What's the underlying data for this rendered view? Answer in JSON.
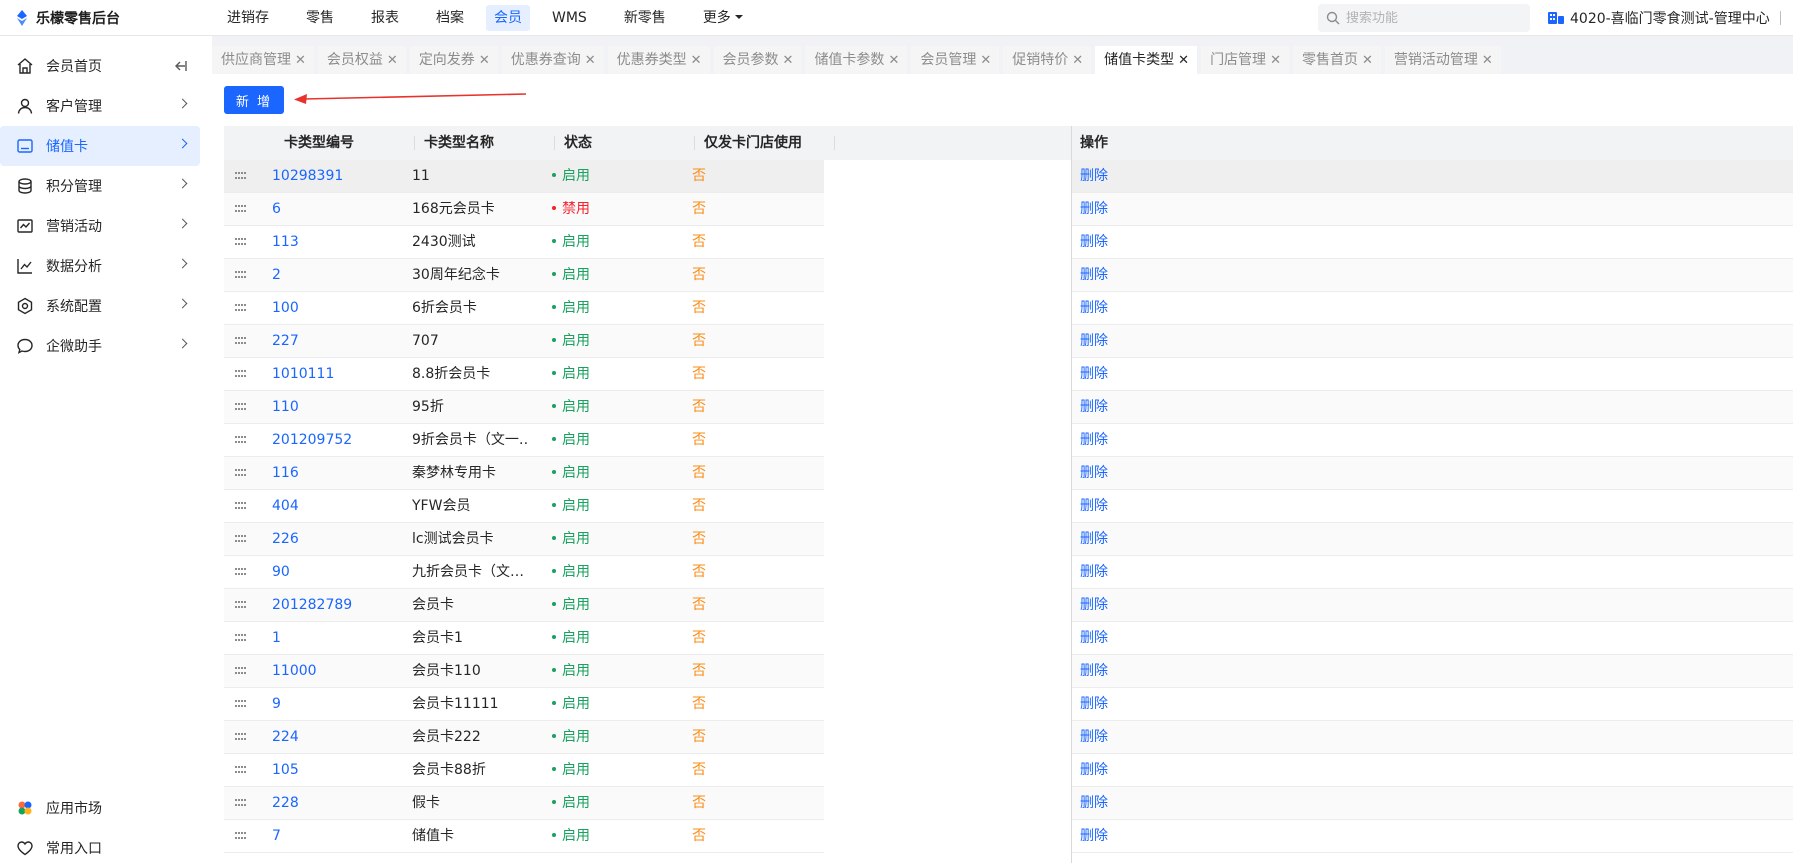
{
  "app": {
    "title": "乐檬零售后台"
  },
  "topnav": {
    "items": [
      "进销存",
      "零售",
      "报表",
      "档案",
      "会员",
      "WMS",
      "新零售"
    ],
    "active": "会员",
    "more": "更多"
  },
  "search": {
    "placeholder": "搜索功能"
  },
  "org": {
    "name": "4020-喜临门零食测试-管理中心"
  },
  "sidebar": {
    "items": [
      {
        "label": "会员首页",
        "icon": "home-icon"
      },
      {
        "label": "客户管理",
        "icon": "user-icon"
      },
      {
        "label": "储值卡",
        "icon": "card-icon"
      },
      {
        "label": "积分管理",
        "icon": "database-icon"
      },
      {
        "label": "营销活动",
        "icon": "chart-board-icon"
      },
      {
        "label": "数据分析",
        "icon": "line-chart-icon"
      },
      {
        "label": "系统配置",
        "icon": "settings-hex-icon"
      },
      {
        "label": "企微助手",
        "icon": "chat-icon"
      }
    ],
    "bottom": [
      {
        "label": "应用市场",
        "icon": "app-market-icon"
      },
      {
        "label": "常用入口",
        "icon": "heart-icon"
      }
    ]
  },
  "tabs": [
    "供应商管理",
    "会员权益",
    "定向发券",
    "优惠券查询",
    "优惠券类型",
    "会员参数",
    "储值卡参数",
    "会员管理",
    "促销特价",
    "储值卡类型",
    "门店管理",
    "零售首页",
    "营销活动管理"
  ],
  "toolbar": {
    "add_label": "新 增"
  },
  "table": {
    "headers": {
      "code": "卡类型编号",
      "name": "卡类型名称",
      "status": "状态",
      "store_only": "仅发卡门店使用",
      "ops": "操作"
    },
    "delete_label": "删除",
    "rows": [
      {
        "code": "10298391",
        "name": "11",
        "status": "启用",
        "store_only": "否"
      },
      {
        "code": "6",
        "name": "168元会员卡",
        "status": "禁用",
        "store_only": "否"
      },
      {
        "code": "113",
        "name": "2430测试",
        "status": "启用",
        "store_only": "否"
      },
      {
        "code": "2",
        "name": "30周年纪念卡",
        "status": "启用",
        "store_only": "否"
      },
      {
        "code": "100",
        "name": "6折会员卡",
        "status": "启用",
        "store_only": "否"
      },
      {
        "code": "227",
        "name": "707",
        "status": "启用",
        "store_only": "否"
      },
      {
        "code": "1010111",
        "name": "8.8折会员卡",
        "status": "启用",
        "store_only": "否"
      },
      {
        "code": "110",
        "name": "95折",
        "status": "启用",
        "store_only": "否"
      },
      {
        "code": "201209752",
        "name": "9折会员卡（文一…",
        "status": "启用",
        "store_only": "否"
      },
      {
        "code": "116",
        "name": "秦梦林专用卡",
        "status": "启用",
        "store_only": "否"
      },
      {
        "code": "404",
        "name": "YFW会员",
        "status": "启用",
        "store_only": "否"
      },
      {
        "code": "226",
        "name": "lc测试会员卡",
        "status": "启用",
        "store_only": "否"
      },
      {
        "code": "90",
        "name": "九折会员卡（文…",
        "status": "启用",
        "store_only": "否"
      },
      {
        "code": "201282789",
        "name": "会员卡",
        "status": "启用",
        "store_only": "否"
      },
      {
        "code": "1",
        "name": "会员卡1",
        "status": "启用",
        "store_only": "否"
      },
      {
        "code": "11000",
        "name": "会员卡110",
        "status": "启用",
        "store_only": "否"
      },
      {
        "code": "9",
        "name": "会员卡11111",
        "status": "启用",
        "store_only": "否"
      },
      {
        "code": "224",
        "name": "会员卡222",
        "status": "启用",
        "store_only": "否"
      },
      {
        "code": "105",
        "name": "会员卡88折",
        "status": "启用",
        "store_only": "否"
      },
      {
        "code": "228",
        "name": "假卡",
        "status": "启用",
        "store_only": "否"
      },
      {
        "code": "7",
        "name": "储值卡",
        "status": "启用",
        "store_only": "否"
      }
    ]
  },
  "colors": {
    "accent": "#1a66ff",
    "enabled": "#19a15f",
    "disabled": "#f5222d",
    "no": "#fa8c16",
    "annotation": "#e8322b"
  }
}
